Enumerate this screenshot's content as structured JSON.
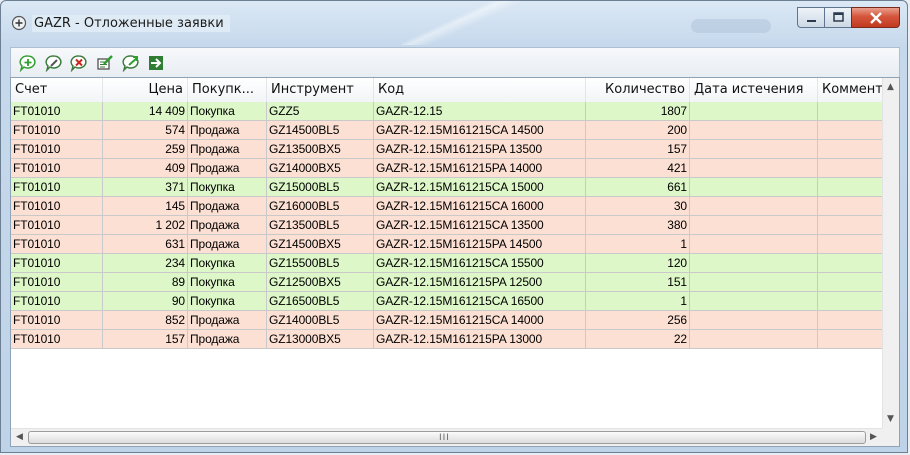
{
  "window": {
    "title": "GAZR - Отложенные заявки"
  },
  "toolbar": {
    "buttons": [
      {
        "icon": "add-order-icon",
        "color": "#2e9e2e"
      },
      {
        "icon": "edit-order-icon",
        "color": "#3a7a3a"
      },
      {
        "icon": "delete-order-icon",
        "color": "#c8281e"
      },
      {
        "icon": "edit-all-icon",
        "color": "#3a7a3a"
      },
      {
        "icon": "execute-icon",
        "color": "#2e9e2e"
      },
      {
        "icon": "export-icon",
        "color": "#2e9e2e"
      }
    ]
  },
  "table": {
    "columns": [
      "Счет",
      "Цена",
      "Покупк...",
      "Инструмент",
      "Код",
      "Количество",
      "Дата истечения",
      "Коммент.."
    ],
    "colors": {
      "buy": "#ddf7c8",
      "sell": "#fce0d3"
    },
    "rows": [
      {
        "side": "buy",
        "account": "FT01010",
        "price": "14 409",
        "operation": "Покупка",
        "instrument": "GZZ5",
        "code": "GAZR-12.15",
        "quantity": "1807",
        "expiry": "",
        "comment": ""
      },
      {
        "side": "sell",
        "account": "FT01010",
        "price": "574",
        "operation": "Продажа",
        "instrument": "GZ14500BL5",
        "code": "GAZR-12.15M161215CA 14500",
        "quantity": "200",
        "expiry": "",
        "comment": ""
      },
      {
        "side": "sell",
        "account": "FT01010",
        "price": "259",
        "operation": "Продажа",
        "instrument": "GZ13500BX5",
        "code": "GAZR-12.15M161215PA 13500",
        "quantity": "157",
        "expiry": "",
        "comment": ""
      },
      {
        "side": "sell",
        "account": "FT01010",
        "price": "409",
        "operation": "Продажа",
        "instrument": "GZ14000BX5",
        "code": "GAZR-12.15M161215PA 14000",
        "quantity": "421",
        "expiry": "",
        "comment": ""
      },
      {
        "side": "buy",
        "account": "FT01010",
        "price": "371",
        "operation": "Покупка",
        "instrument": "GZ15000BL5",
        "code": "GAZR-12.15M161215CA 15000",
        "quantity": "661",
        "expiry": "",
        "comment": ""
      },
      {
        "side": "sell",
        "account": "FT01010",
        "price": "145",
        "operation": "Продажа",
        "instrument": "GZ16000BL5",
        "code": "GAZR-12.15M161215CA 16000",
        "quantity": "30",
        "expiry": "",
        "comment": ""
      },
      {
        "side": "sell",
        "account": "FT01010",
        "price": "1 202",
        "operation": "Продажа",
        "instrument": "GZ13500BL5",
        "code": "GAZR-12.15M161215CA 13500",
        "quantity": "380",
        "expiry": "",
        "comment": ""
      },
      {
        "side": "sell",
        "account": "FT01010",
        "price": "631",
        "operation": "Продажа",
        "instrument": "GZ14500BX5",
        "code": "GAZR-12.15M161215PA 14500",
        "quantity": "1",
        "expiry": "",
        "comment": ""
      },
      {
        "side": "buy",
        "account": "FT01010",
        "price": "234",
        "operation": "Покупка",
        "instrument": "GZ15500BL5",
        "code": "GAZR-12.15M161215CA 15500",
        "quantity": "120",
        "expiry": "",
        "comment": ""
      },
      {
        "side": "buy",
        "account": "FT01010",
        "price": "89",
        "operation": "Покупка",
        "instrument": "GZ12500BX5",
        "code": "GAZR-12.15M161215PA 12500",
        "quantity": "151",
        "expiry": "",
        "comment": ""
      },
      {
        "side": "buy",
        "account": "FT01010",
        "price": "90",
        "operation": "Покупка",
        "instrument": "GZ16500BL5",
        "code": "GAZR-12.15M161215CA 16500",
        "quantity": "1",
        "expiry": "",
        "comment": ""
      },
      {
        "side": "sell",
        "account": "FT01010",
        "price": "852",
        "operation": "Продажа",
        "instrument": "GZ14000BL5",
        "code": "GAZR-12.15M161215CA 14000",
        "quantity": "256",
        "expiry": "",
        "comment": ""
      },
      {
        "side": "sell",
        "account": "FT01010",
        "price": "157",
        "operation": "Продажа",
        "instrument": "GZ13000BX5",
        "code": "GAZR-12.15M161215PA 13000",
        "quantity": "22",
        "expiry": "",
        "comment": ""
      }
    ]
  },
  "scrollbar": {
    "grip": "III"
  }
}
